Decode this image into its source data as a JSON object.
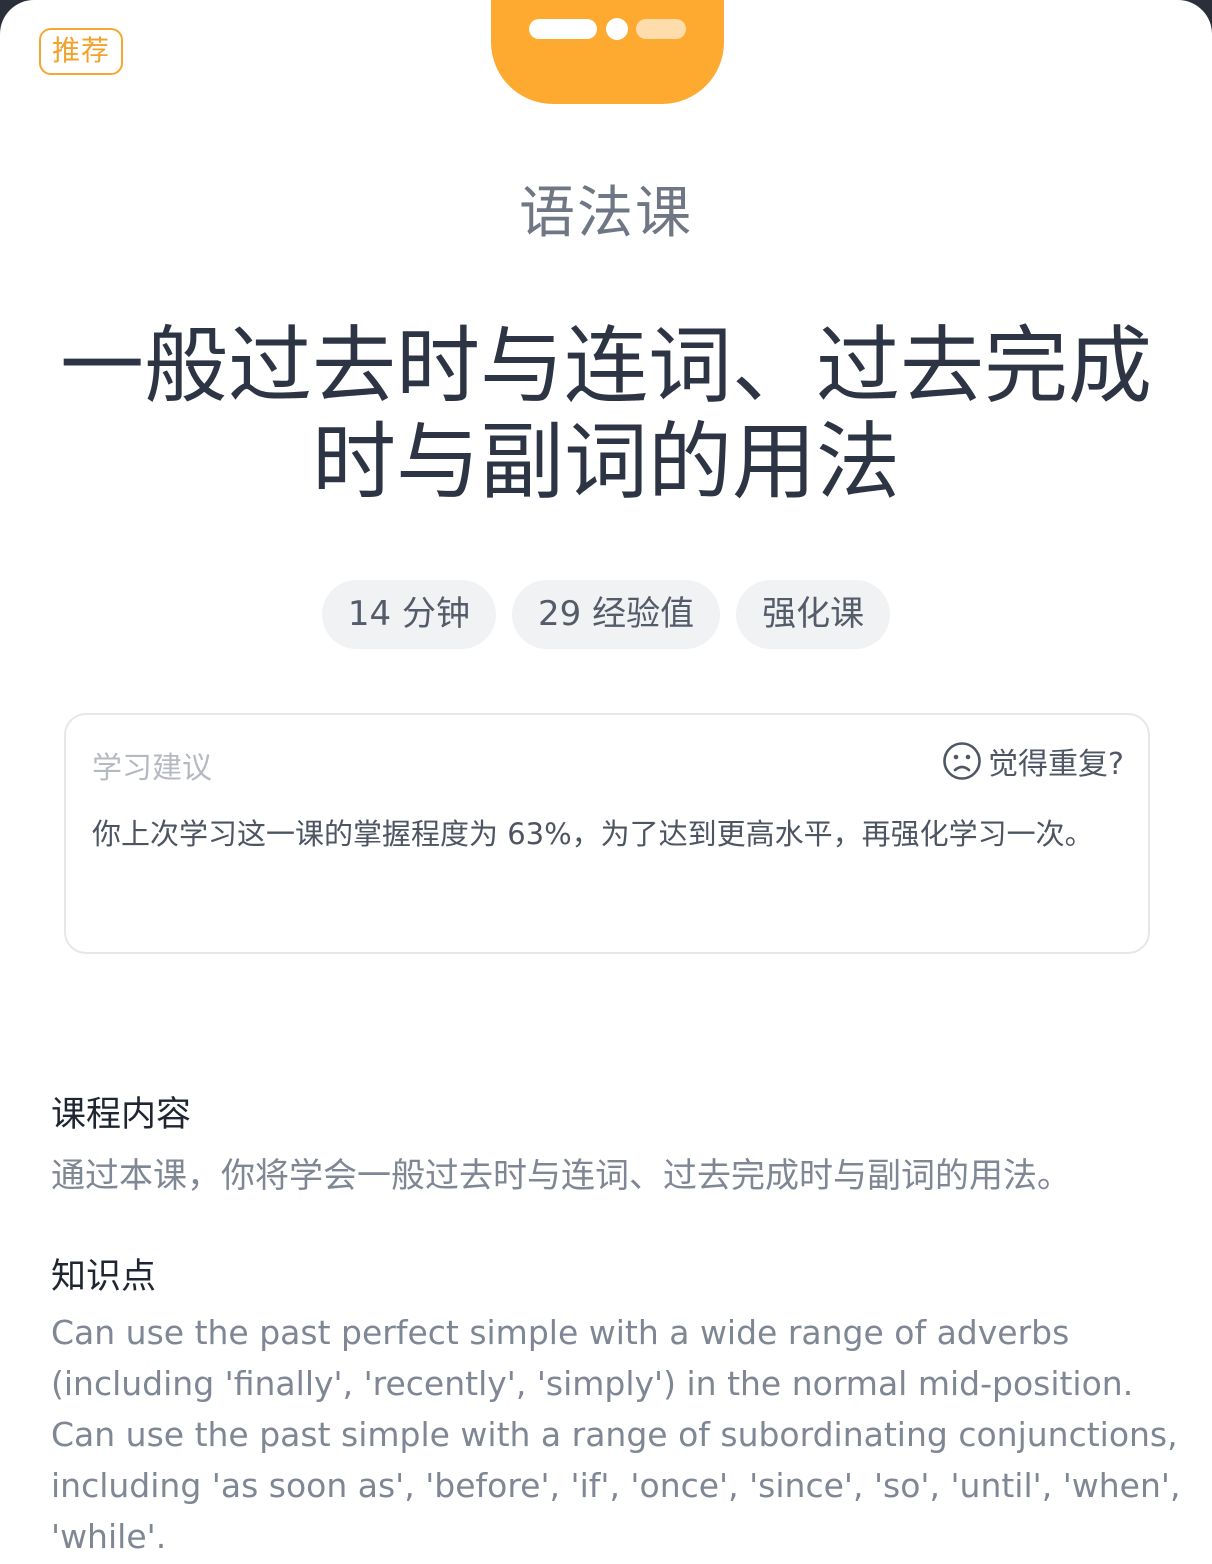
{
  "badge": {
    "label": "推荐"
  },
  "hero": {
    "color": "#fea92f",
    "indicator": [
      "bar",
      "dot",
      "bar"
    ]
  },
  "lesson": {
    "category": "语法课",
    "title_line1": "一般过去时与连词、过去完成",
    "title_line2": "时与副词的用法"
  },
  "tags": [
    {
      "label": "14 分钟"
    },
    {
      "label": "29 经验值"
    },
    {
      "label": "强化课"
    }
  ],
  "advice": {
    "label": "学习建议",
    "repeat_label": "觉得重复?",
    "repeat_icon": "sad-face-icon",
    "text": "你上次学习这一课的掌握程度为 63%，为了达到更高水平，再强化学习一次。"
  },
  "content": {
    "title": "课程内容",
    "text": "通过本课，你将学会一般过去时与连词、过去完成时与副词的用法。"
  },
  "knowledge": {
    "title": "知识点",
    "lines": [
      "Can use the past perfect simple with a wide range of adverbs",
      "(including 'finally', 'recently', 'simply') in the normal mid-position.",
      "Can use the past simple with a range of subordinating conjunctions,",
      "including 'as soon as', 'before', 'if', 'once', 'since', 'so', 'until', 'when',",
      "'while'."
    ]
  }
}
